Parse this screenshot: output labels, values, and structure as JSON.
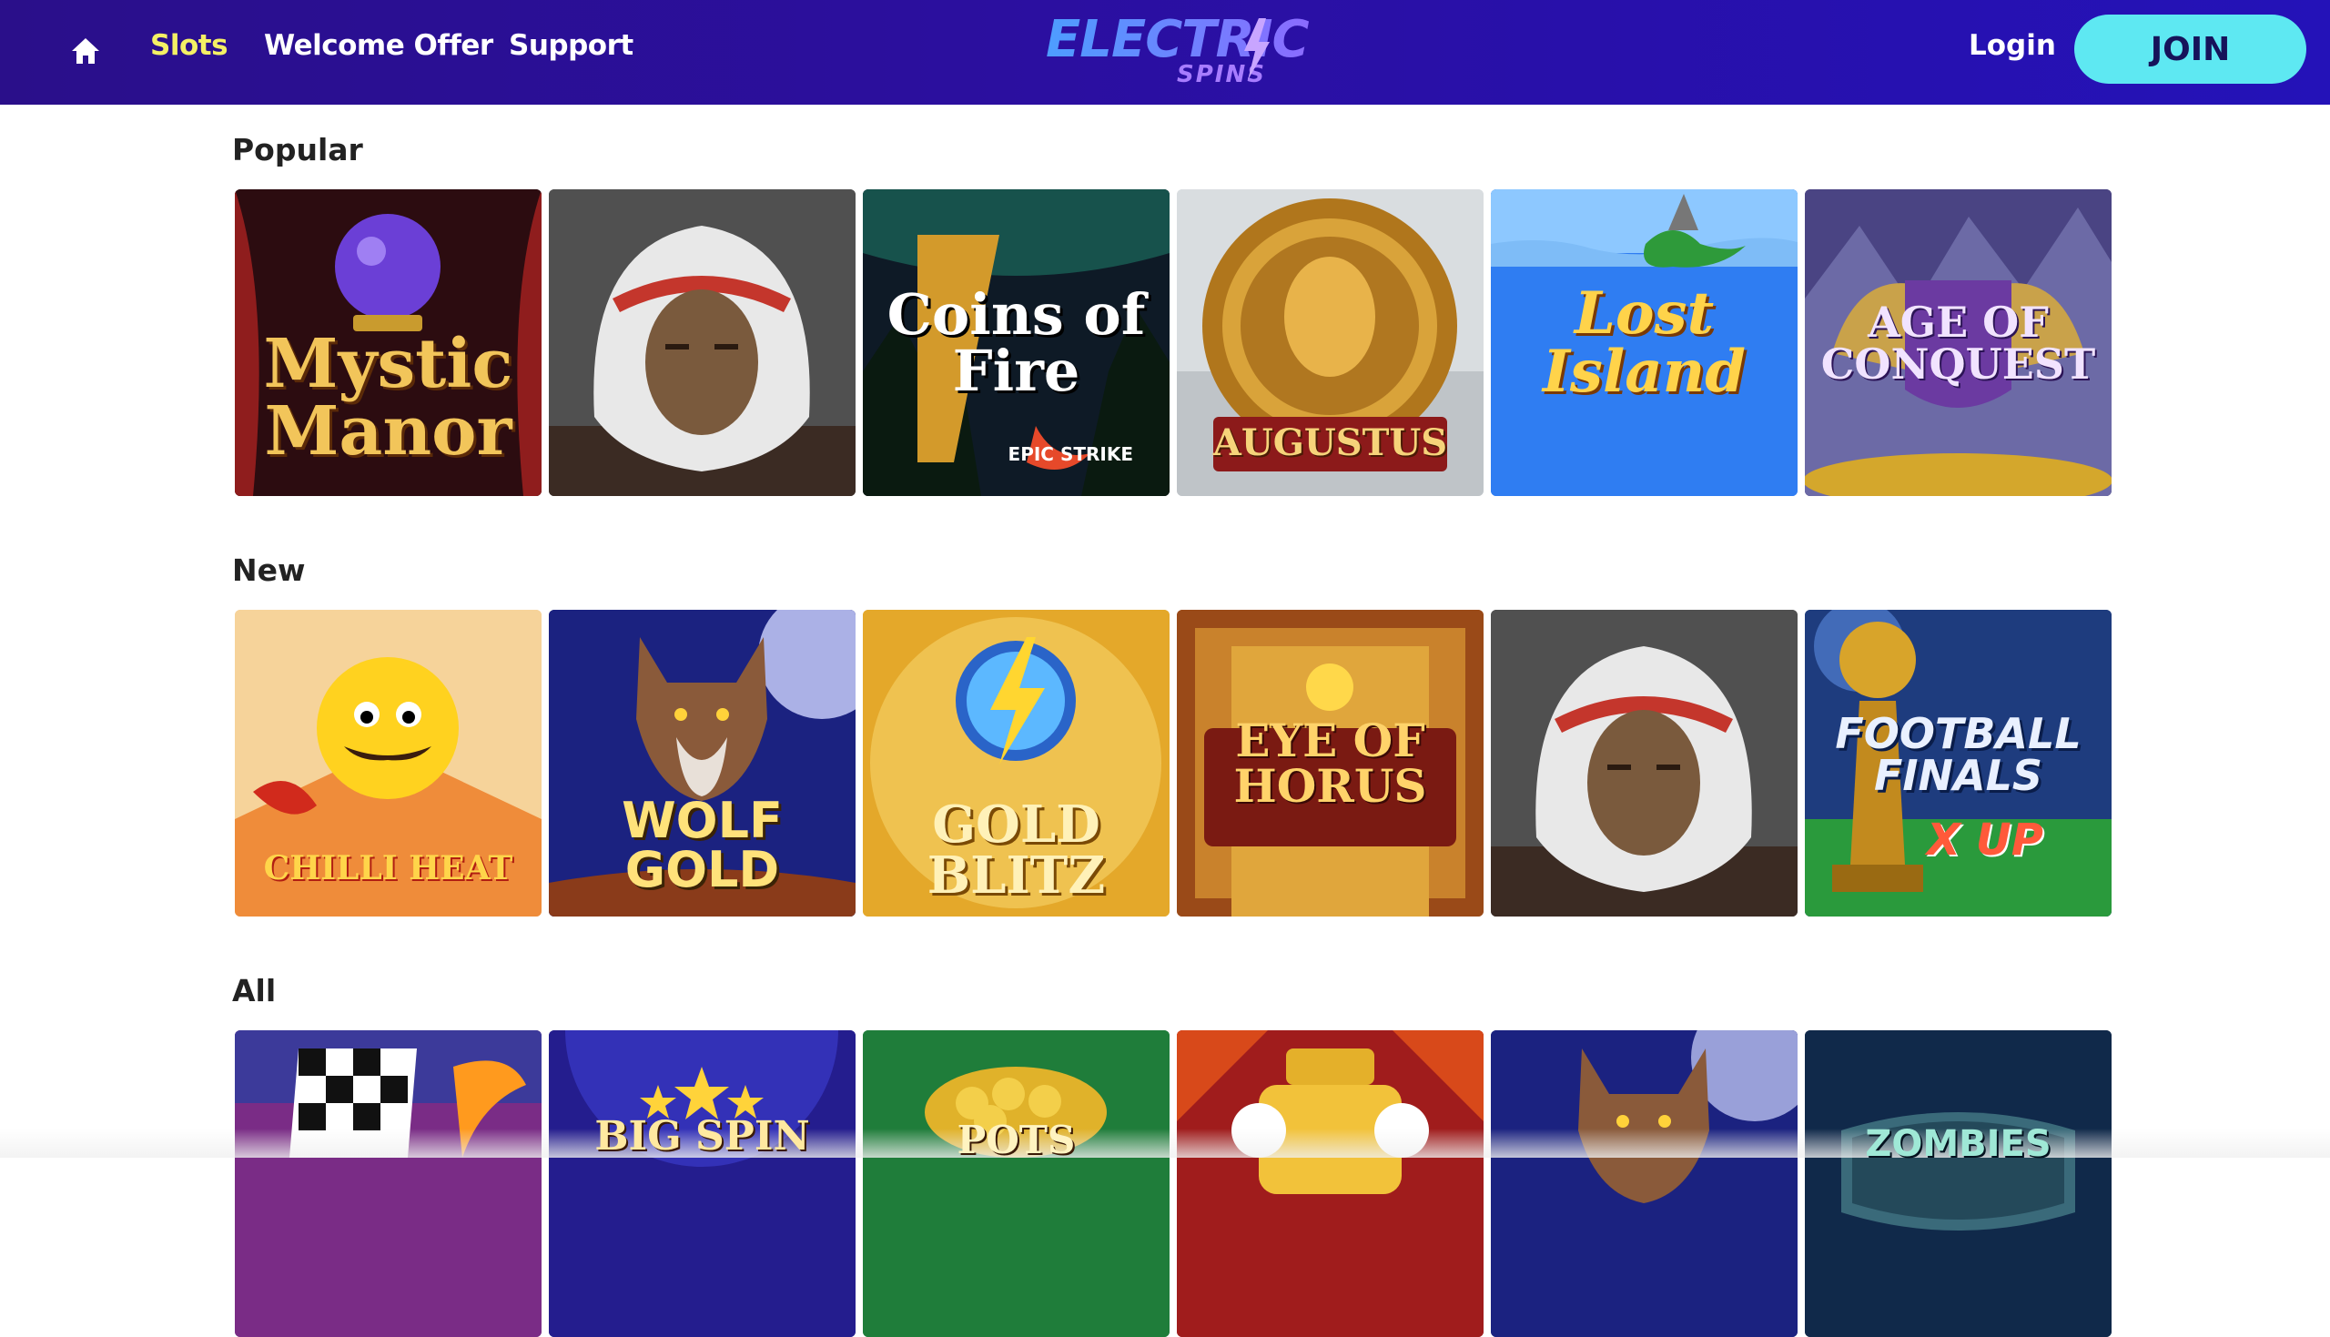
{
  "header": {
    "nav": [
      {
        "label": "Slots",
        "active": true
      },
      {
        "label": "Welcome Offer",
        "active": false
      },
      {
        "label": "Support",
        "active": false
      }
    ],
    "logo": {
      "line1": "ELECTRIC",
      "line2": "SPINS"
    },
    "login_label": "Login",
    "join_label": "JOIN"
  },
  "sections": [
    {
      "title": "Popular",
      "games": [
        {
          "title": "Mystic Manor",
          "icon": "crystal-ball-icon"
        },
        {
          "title": "",
          "icon": "chief-headdress-icon"
        },
        {
          "title": "Coins of Fire",
          "subtitle": "EPIC STRIKE",
          "icon": "fire-coins-icon"
        },
        {
          "title": "AUGUSTUS",
          "icon": "roman-coin-icon"
        },
        {
          "title": "Lost Island",
          "icon": "island-icon"
        },
        {
          "title": "AGE OF CONQUEST",
          "icon": "winged-shield-icon"
        }
      ]
    },
    {
      "title": "New",
      "games": [
        {
          "title": "CHILLI HEAT",
          "icon": "sun-chilli-icon"
        },
        {
          "title": "WOLF GOLD",
          "icon": "wolf-icon"
        },
        {
          "title": "GOLD BLITZ",
          "icon": "lightning-icon"
        },
        {
          "title": "EYE OF HORUS",
          "icon": "egyptian-gate-icon"
        },
        {
          "title": "",
          "icon": "chief-headdress-icon"
        },
        {
          "title": "FOOTBALL FINALS",
          "subtitle": "X UP",
          "icon": "trophy-icon"
        }
      ]
    },
    {
      "title": "All",
      "games": [
        {
          "title": "",
          "icon": "checkered-flag-icon"
        },
        {
          "title": "BIG SPIN",
          "icon": "stars-icon"
        },
        {
          "title": "POTS",
          "icon": "gold-pot-icon"
        },
        {
          "title": "",
          "icon": "slot-machine-icon"
        },
        {
          "title": "",
          "icon": "wolf-icon"
        },
        {
          "title": "ZOMBIES",
          "icon": "zombie-shield-icon"
        }
      ]
    }
  ],
  "colors": {
    "header_bg": "#2b0fa0",
    "active_nav": "#f4f065",
    "join_bg": "#5ee8f2",
    "join_text": "#16135a"
  }
}
